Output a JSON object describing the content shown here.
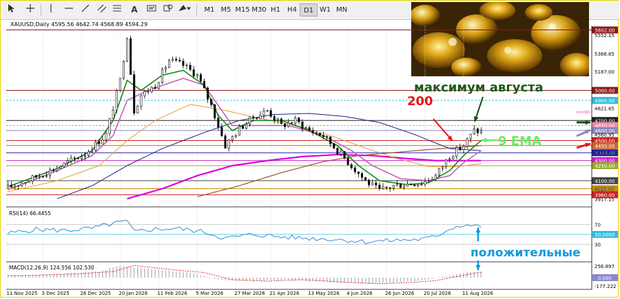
{
  "toolbar": {
    "timeframes": [
      {
        "label": "M1",
        "active": false
      },
      {
        "label": "M5",
        "active": false
      },
      {
        "label": "M15",
        "active": false
      },
      {
        "label": "M30",
        "active": false
      },
      {
        "label": "H1",
        "active": false
      },
      {
        "label": "H4",
        "active": false
      },
      {
        "label": "D1",
        "active": true
      },
      {
        "label": "W1",
        "active": false
      },
      {
        "label": "MN",
        "active": false
      }
    ],
    "icons": [
      "cursor-icon",
      "crosshair-icon",
      "vertical-line-icon",
      "horizontal-line-icon",
      "trendline-icon",
      "channel-icon",
      "fibonacci-icon",
      "text-icon",
      "label-icon",
      "shapes-icon"
    ]
  },
  "chart_header": "XAUUSD,Daily  4595.56 4642.74 4568.89 4594.29",
  "chart_data": {
    "type": "candlestick",
    "symbol": "XAUUSD",
    "timeframe": "Daily",
    "ohlc_header": {
      "open": 4595.56,
      "high": 4642.74,
      "low": 4568.89,
      "close": 4594.29
    },
    "x_labels": [
      "11 Nov 2025",
      "3 Dec 2025",
      "26 Dec 2025",
      "20 Jan 2026",
      "11 Feb 2026",
      "5 Mar 2026",
      "27 Mar 2026",
      "21 Apr 2026",
      "13 May 2026",
      "4 Jun 2026",
      "26 Jun 2026",
      "20 Jul 2026",
      "11 Aug 2026"
    ],
    "y_ticks": [
      5552.15,
      5366.85,
      5187.0,
      4821.85,
      4560.95,
      4378.6,
      4020.0,
      3917.15
    ],
    "ylim": [
      3880,
      5640
    ],
    "price_levels": [
      {
        "value": 5602.0,
        "label": "5602.00",
        "color": "#8b1a1a"
      },
      {
        "value": 5000.0,
        "label": "5000.00",
        "color": "#8b1a1a"
      },
      {
        "value": 4900.0,
        "label": "4900.00",
        "color": "#33bbdd"
      },
      {
        "value": 4700.0,
        "label": "4700.00",
        "color": "#222222"
      },
      {
        "value": 4650.0,
        "label": "4650.00",
        "color": "#ee88aa"
      },
      {
        "value": 4600.0,
        "label": "4600.00",
        "color": "#8888bb"
      },
      {
        "value": 4500.0,
        "label": "4500.00",
        "color": "#cc2222"
      },
      {
        "value": 4450.0,
        "label": "4450.00",
        "color": "#cc6633"
      },
      {
        "value": 4378.6,
        "label": "4378.60",
        "color": "#2222aa"
      },
      {
        "value": 4300.0,
        "label": "4300.00",
        "color": "#cc22cc"
      },
      {
        "value": 4250.0,
        "label": "4250.00",
        "color": "#99aa33"
      },
      {
        "value": 4100.0,
        "label": "4100.00",
        "color": "#444444"
      },
      {
        "value": 4020.0,
        "label": "4020.00",
        "color": "#cc8800"
      },
      {
        "value": 3960.0,
        "label": "3960.00",
        "color": "#cc2222"
      }
    ],
    "series_anchors": {
      "price": [
        [
          0,
          4030
        ],
        [
          6,
          4110
        ],
        [
          14,
          4230
        ],
        [
          22,
          4370
        ],
        [
          28,
          4560
        ],
        [
          32,
          5100
        ],
        [
          34,
          5550
        ],
        [
          36,
          4800
        ],
        [
          38,
          4950
        ],
        [
          42,
          5050
        ],
        [
          46,
          5300
        ],
        [
          50,
          5250
        ],
        [
          54,
          5150
        ],
        [
          58,
          4850
        ],
        [
          62,
          4450
        ],
        [
          66,
          4620
        ],
        [
          70,
          4730
        ],
        [
          74,
          4800
        ],
        [
          78,
          4650
        ],
        [
          82,
          4700
        ],
        [
          86,
          4600
        ],
        [
          90,
          4550
        ],
        [
          94,
          4400
        ],
        [
          98,
          4250
        ],
        [
          102,
          4100
        ],
        [
          106,
          4000
        ],
        [
          110,
          4050
        ],
        [
          114,
          4070
        ],
        [
          118,
          4080
        ],
        [
          122,
          4150
        ],
        [
          126,
          4350
        ],
        [
          130,
          4450
        ],
        [
          133,
          4600
        ],
        [
          135,
          4590
        ]
      ],
      "ema9": [
        [
          0,
          4040
        ],
        [
          14,
          4220
        ],
        [
          24,
          4400
        ],
        [
          30,
          4700
        ],
        [
          34,
          5100
        ],
        [
          38,
          5000
        ],
        [
          44,
          5150
        ],
        [
          50,
          5200
        ],
        [
          56,
          5050
        ],
        [
          60,
          4750
        ],
        [
          64,
          4600
        ],
        [
          70,
          4700
        ],
        [
          78,
          4700
        ],
        [
          86,
          4600
        ],
        [
          94,
          4450
        ],
        [
          100,
          4250
        ],
        [
          106,
          4100
        ],
        [
          114,
          4060
        ],
        [
          120,
          4080
        ],
        [
          126,
          4200
        ],
        [
          130,
          4350
        ],
        [
          135,
          4500
        ]
      ],
      "ma_magenta_mid": [
        [
          0,
          4010
        ],
        [
          14,
          4200
        ],
        [
          24,
          4350
        ],
        [
          30,
          4550
        ],
        [
          34,
          4900
        ],
        [
          40,
          5000
        ],
        [
          50,
          5120
        ],
        [
          56,
          5050
        ],
        [
          60,
          4850
        ],
        [
          64,
          4650
        ],
        [
          70,
          4650
        ],
        [
          80,
          4650
        ],
        [
          90,
          4550
        ],
        [
          98,
          4400
        ],
        [
          104,
          4250
        ],
        [
          112,
          4120
        ],
        [
          120,
          4100
        ],
        [
          126,
          4150
        ],
        [
          130,
          4280
        ],
        [
          135,
          4400
        ]
      ],
      "ma_orange": [
        [
          0,
          3990
        ],
        [
          14,
          4100
        ],
        [
          26,
          4250
        ],
        [
          34,
          4500
        ],
        [
          42,
          4700
        ],
        [
          52,
          4860
        ],
        [
          62,
          4800
        ],
        [
          72,
          4720
        ],
        [
          82,
          4650
        ],
        [
          92,
          4550
        ],
        [
          100,
          4450
        ],
        [
          110,
          4330
        ],
        [
          120,
          4240
        ],
        [
          128,
          4240
        ],
        [
          135,
          4270
        ]
      ],
      "ma_navy": [
        [
          14,
          3920
        ],
        [
          24,
          4050
        ],
        [
          34,
          4250
        ],
        [
          44,
          4420
        ],
        [
          56,
          4580
        ],
        [
          66,
          4700
        ],
        [
          76,
          4760
        ],
        [
          86,
          4770
        ],
        [
          96,
          4740
        ],
        [
          106,
          4680
        ],
        [
          116,
          4560
        ],
        [
          126,
          4420
        ],
        [
          135,
          4400
        ]
      ],
      "ma_magenta_slow": [
        [
          34,
          3920
        ],
        [
          44,
          4020
        ],
        [
          54,
          4150
        ],
        [
          64,
          4250
        ],
        [
          74,
          4300
        ],
        [
          84,
          4340
        ],
        [
          94,
          4360
        ],
        [
          104,
          4350
        ],
        [
          114,
          4320
        ],
        [
          122,
          4300
        ],
        [
          135,
          4300
        ]
      ],
      "ma_brown": [
        [
          54,
          3940
        ],
        [
          66,
          4050
        ],
        [
          78,
          4180
        ],
        [
          90,
          4290
        ],
        [
          100,
          4350
        ],
        [
          110,
          4380
        ],
        [
          120,
          4410
        ],
        [
          135,
          4450
        ]
      ]
    }
  },
  "annotations": {
    "photo_alt": "gold nuggets",
    "max_august": "максимум августа",
    "ma200": "200",
    "ema9": "9 EMA",
    "positive": "положительные"
  },
  "rsi": {
    "label": "RSI(14) 66.4455",
    "levels": [
      "70",
      "50.0000",
      "30"
    ],
    "values": [
      [
        0,
        52
      ],
      [
        8,
        60
      ],
      [
        16,
        58
      ],
      [
        24,
        62
      ],
      [
        30,
        72
      ],
      [
        34,
        76
      ],
      [
        36,
        55
      ],
      [
        40,
        60
      ],
      [
        48,
        62
      ],
      [
        56,
        55
      ],
      [
        62,
        42
      ],
      [
        70,
        50
      ],
      [
        78,
        45
      ],
      [
        86,
        42
      ],
      [
        94,
        40
      ],
      [
        102,
        35
      ],
      [
        110,
        38
      ],
      [
        118,
        40
      ],
      [
        122,
        45
      ],
      [
        126,
        62
      ],
      [
        130,
        70
      ],
      [
        135,
        66
      ]
    ]
  },
  "macd": {
    "label": "MACD(12,26,9) 124.556 102.530",
    "ticks": [
      "256.897",
      "0.000",
      "-177.222"
    ],
    "hist_anchors": [
      [
        0,
        40
      ],
      [
        14,
        70
      ],
      [
        26,
        120
      ],
      [
        32,
        240
      ],
      [
        36,
        210
      ],
      [
        44,
        150
      ],
      [
        52,
        100
      ],
      [
        60,
        -40
      ],
      [
        70,
        -70
      ],
      [
        80,
        -40
      ],
      [
        92,
        -90
      ],
      [
        102,
        -120
      ],
      [
        110,
        -100
      ],
      [
        118,
        -60
      ],
      [
        124,
        20
      ],
      [
        130,
        100
      ],
      [
        135,
        120
      ]
    ]
  }
}
